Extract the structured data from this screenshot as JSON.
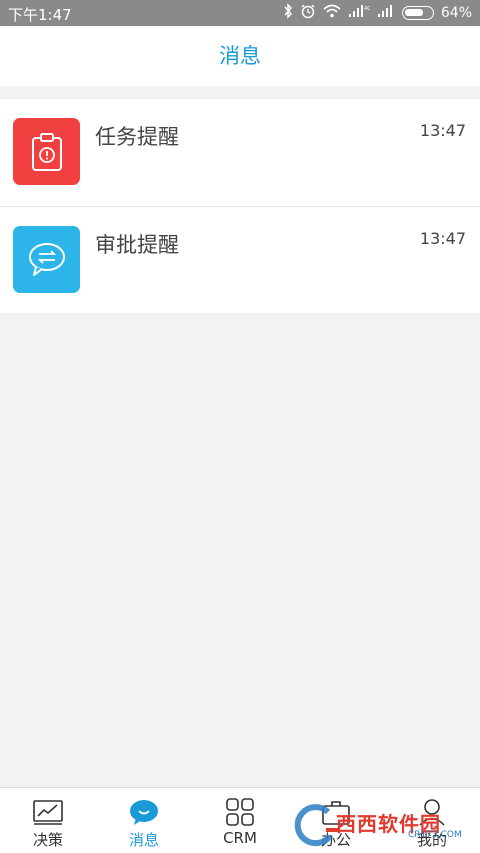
{
  "status_bar": {
    "time": "下午1:47",
    "battery": "64%",
    "icons": [
      "bluetooth-icon",
      "alarm-icon",
      "wifi-icon",
      "signal-icon",
      "signal-icon",
      "battery-icon"
    ]
  },
  "header": {
    "title": "消息"
  },
  "messages": [
    {
      "label": "任务提醒",
      "time": "13:47",
      "icon": "clipboard-alert-icon",
      "color": "#f04040"
    },
    {
      "label": "审批提醒",
      "time": "13:47",
      "icon": "chat-exchange-icon",
      "color": "#2db4e8"
    }
  ],
  "tabs": [
    {
      "label": "决策",
      "icon": "chart-icon",
      "active": false
    },
    {
      "label": "消息",
      "icon": "message-icon",
      "active": true
    },
    {
      "label": "CRM",
      "icon": "grid-icon",
      "active": false
    },
    {
      "label": "办公",
      "icon": "briefcase-icon",
      "active": false
    },
    {
      "label": "我的",
      "icon": "person-icon",
      "active": false
    }
  ],
  "colors": {
    "accent": "#1a9ad6",
    "status_bar": "#8a8a8a",
    "background": "#f2f2f2"
  },
  "watermark": {
    "text": "西西软件园",
    "sub": "CR173.COM"
  }
}
